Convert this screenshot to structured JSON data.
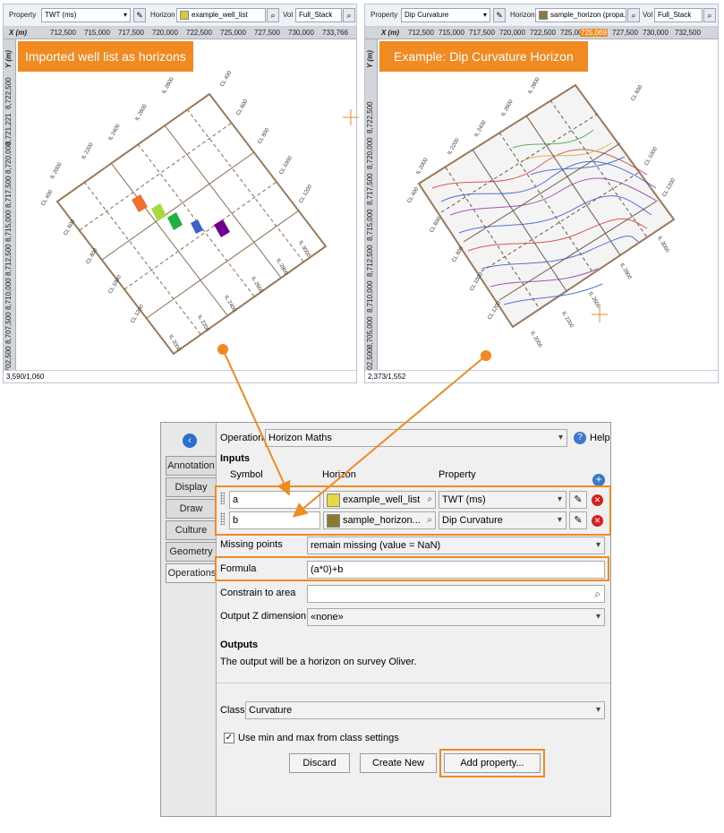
{
  "left_view": {
    "toolbar": {
      "property_label": "Property",
      "property_value": "TWT (ms)",
      "horizon_label": "Horizon",
      "horizon_value": "example_well_list",
      "vol_label": "Vol",
      "vol_value": "Full_Stack"
    },
    "x_axis_label": "X (m)",
    "x_ticks": [
      "712,500",
      "715,000",
      "717,500",
      "720,000",
      "722,500",
      "725,000",
      "727,500",
      "730,000",
      "733,766"
    ],
    "y_axis_label": "Y (m)",
    "y_ticks": [
      "8,725,000",
      "8,722,500",
      "8,721,221",
      "8,720,000",
      "8,717,500",
      "8,715,000",
      "8,712,500",
      "8,710,000",
      "8,707,500",
      "8,705,000",
      "8,702,500"
    ],
    "status": "3,590/1,060",
    "callout": "Imported well list as horizons",
    "grid_labels": [
      "IL 2800",
      "IL 2600",
      "IL 2400",
      "IL 2200",
      "IL 2000",
      "CL 400",
      "CL 600",
      "CL 800",
      "CL 1000",
      "CL 1200",
      "IL 3000",
      "IL 2800",
      "IL 2600",
      "IL 2400",
      "IL 2200",
      "CL 400",
      "CL 600",
      "CL 800",
      "CL 1000",
      "CL 1200",
      "IL 3000",
      "IL 2000"
    ]
  },
  "right_view": {
    "toolbar": {
      "property_label": "Property",
      "property_value": "Dip Curvature",
      "horizon_label": "Horizon",
      "horizon_value": "sample_horizon (propa...",
      "vol_label": "Vol",
      "vol_value": "Full_Stack"
    },
    "x_axis_label": "X (m)",
    "x_ticks": [
      "712,500",
      "715,000",
      "717,500",
      "720,000",
      "722,500",
      "725,000",
      "725,069",
      "727,500",
      "730,000",
      "732,500"
    ],
    "y_axis_label": "Y (m)",
    "y_ticks": [
      "8,725,000",
      "8,722,500",
      "8,720,000",
      "8,717,500",
      "8,715,000",
      "8,712,500",
      "8,710,000",
      "8,707,306",
      "8,705,000",
      "8,702,500"
    ],
    "status": "2,373/1,552",
    "callout": "Example: Dip Curvature Horizon",
    "grid_labels": [
      "IL 2800",
      "IL 2600",
      "IL 2400",
      "IL 2200",
      "IL 2000",
      "CL 400",
      "CL 600",
      "CL 800",
      "CL 1000",
      "CL 1200",
      "IL 3000",
      "IL 2800",
      "IL 2600",
      "IL 2400",
      "IL 2200",
      "CL 400",
      "CL 600",
      "CL 800",
      "CL 1000",
      "CL 1200",
      "IL 3000",
      "IL 2000"
    ]
  },
  "panel": {
    "side_tabs": [
      "Annotation",
      "Display",
      "Draw",
      "Culture",
      "Geometry",
      "Operations"
    ],
    "operation_label": "Operation",
    "operation_value": "Horizon Maths",
    "help_label": "Help",
    "inputs_heading": "Inputs",
    "col_symbol": "Symbol",
    "col_horizon": "Horizon",
    "col_property": "Property",
    "rows": [
      {
        "symbol": "a",
        "horizon": "example_well_list",
        "property": "TWT (ms)"
      },
      {
        "symbol": "b",
        "horizon": "sample_horizon...",
        "property": "Dip Curvature"
      }
    ],
    "missing_label": "Missing points",
    "missing_value": "remain missing (value = NaN)",
    "formula_label": "Formula",
    "formula_value": "(a*0)+b",
    "constrain_label": "Constrain to area",
    "constrain_value": "",
    "outz_label": "Output Z dimension",
    "outz_value": "«none»",
    "outputs_heading": "Outputs",
    "outputs_text": "The output will be a horizon on survey Oliver.",
    "class_label": "Class",
    "class_value": "Curvature",
    "checkbox_label": "Use min and max from class settings",
    "checkbox_checked": true,
    "btn_discard": "Discard",
    "btn_create": "Create New",
    "btn_add": "Add property..."
  },
  "colors": {
    "accent": "#f28a22",
    "well_markers": [
      "#f07030",
      "#a8d840",
      "#20b040",
      "#4060d0",
      "#700090"
    ]
  }
}
